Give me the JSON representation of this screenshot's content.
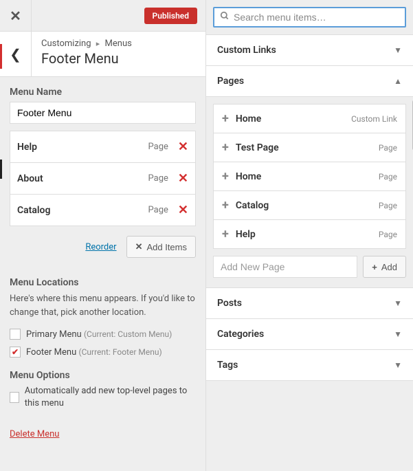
{
  "topbar": {
    "published_badge": "Published"
  },
  "breadcrumb": {
    "root": "Customizing",
    "section": "Menus",
    "title": "Footer Menu"
  },
  "menu_name": {
    "label": "Menu Name",
    "value": "Footer Menu"
  },
  "menu_items": [
    {
      "label": "Help",
      "type": "Page"
    },
    {
      "label": "About",
      "type": "Page"
    },
    {
      "label": "Catalog",
      "type": "Page"
    }
  ],
  "actions": {
    "reorder": "Reorder",
    "add_items": "Add Items"
  },
  "locations": {
    "heading": "Menu Locations",
    "description": "Here's where this menu appears. If you'd like to change that, pick another location.",
    "options": [
      {
        "label": "Primary Menu",
        "note": "(Current: Custom Menu)",
        "checked": false
      },
      {
        "label": "Footer Menu",
        "note": "(Current: Footer Menu)",
        "checked": true
      }
    ]
  },
  "options": {
    "heading": "Menu Options",
    "auto_add_label": "Automatically add new top-level pages to this menu",
    "auto_add_checked": false
  },
  "delete": {
    "label": "Delete Menu"
  },
  "right": {
    "search_placeholder": "Search menu items…",
    "sections": {
      "custom_links": "Custom Links",
      "pages": "Pages",
      "posts": "Posts",
      "categories": "Categories",
      "tags": "Tags"
    },
    "pages_items": [
      {
        "label": "Home",
        "type": "Custom Link"
      },
      {
        "label": "Test Page",
        "type": "Page"
      },
      {
        "label": "Home",
        "type": "Page"
      },
      {
        "label": "Catalog",
        "type": "Page"
      },
      {
        "label": "Help",
        "type": "Page"
      }
    ],
    "add_new_placeholder": "Add New Page",
    "add_button": "Add"
  }
}
